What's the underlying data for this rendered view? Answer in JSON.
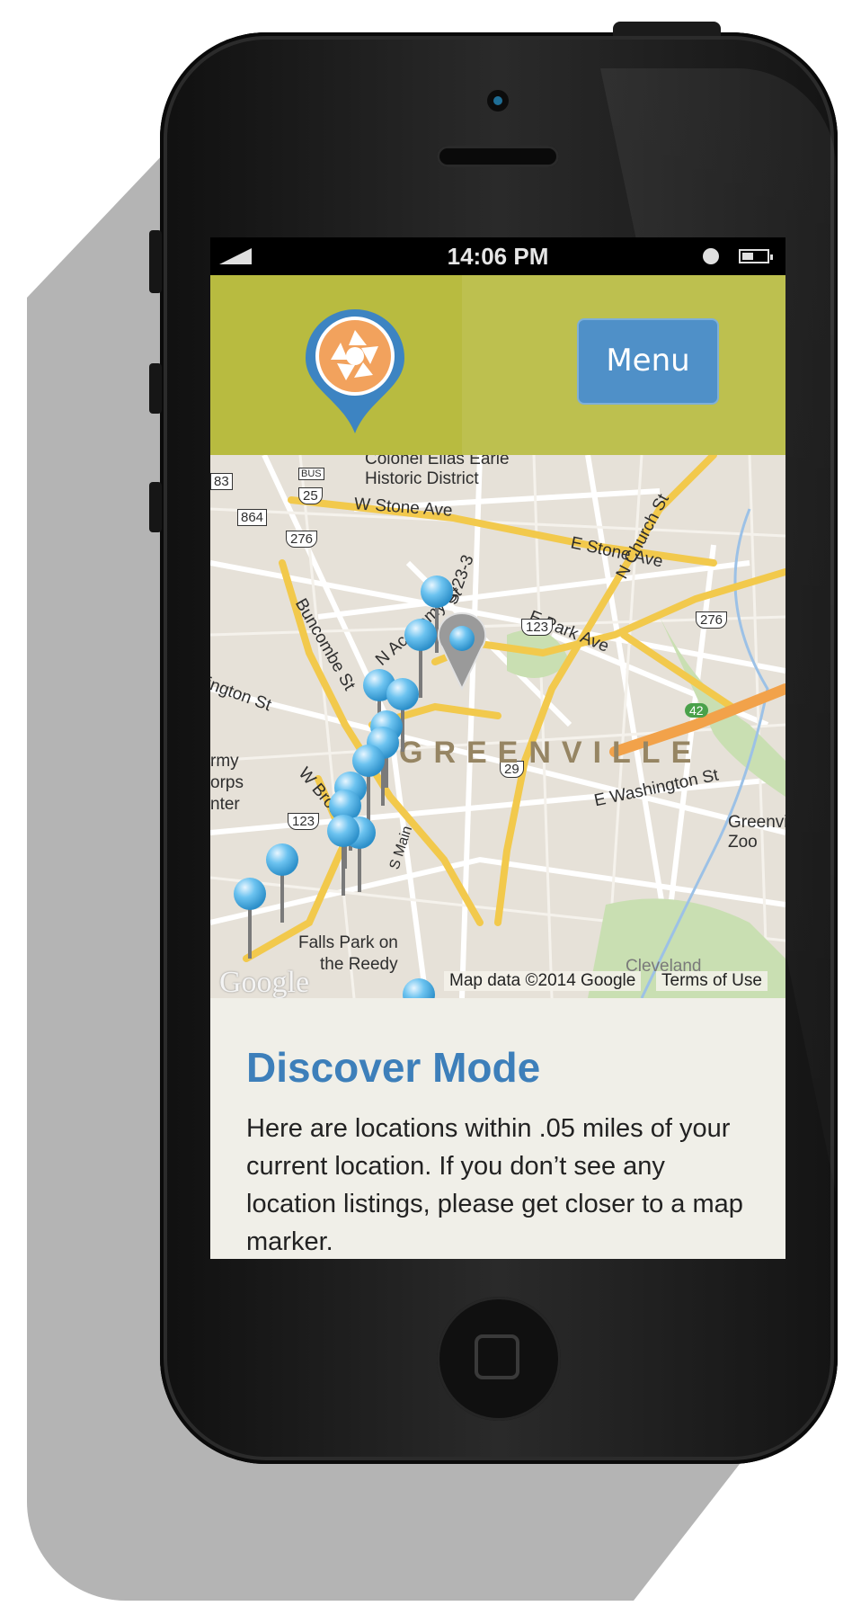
{
  "status_bar": {
    "time": "14:06 PM"
  },
  "header": {
    "menu_label": "Menu",
    "brand_color": "#b8bb40",
    "accent_color": "#4f90c8"
  },
  "map": {
    "labels": {
      "colonel": "Colonel Elias Earle",
      "historic": "Historic District",
      "w_stone": "W Stone Ave",
      "e_stone": "E Stone Ave",
      "n_church": "N Church St",
      "buncombe": "Buncombe St",
      "n_academy": "N Academy St",
      "s23": "S-23-3",
      "e_park": "E Park Ave",
      "washington": "ington St",
      "army1": "rmy",
      "army2": "orps",
      "army3": "nter",
      "w_broad": "W Broa",
      "e_washington": "E Washington St",
      "greenville_zoo1": "Greenvi",
      "greenville_zoo2": "Zoo",
      "falls_park1": "Falls Park on",
      "falls_park2": "the Reedy",
      "cleveland": "Cleveland",
      "shield_83": "83",
      "shield_864": "864",
      "shield_25": "25",
      "shield_bus": "BUS",
      "shield_276a": "276",
      "shield_276b": "276",
      "shield_123a": "123",
      "shield_123b": "123",
      "shield_29": "29",
      "shield_42": "42",
      "s_main": "S Main"
    },
    "city_name": "GREENVILLE",
    "google": "Google",
    "map_data": "Map data ©2014 Google",
    "terms": "Terms of Use"
  },
  "content": {
    "title": "Discover Mode",
    "body": "Here are locations within .05 miles of your current location. If you don’t see any location listings, please get closer to a map marker."
  }
}
